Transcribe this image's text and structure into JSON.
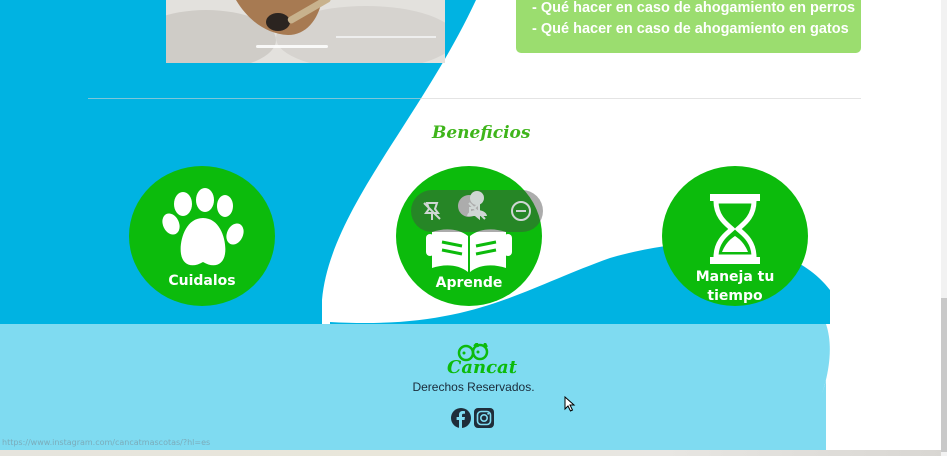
{
  "card": {
    "items": [
      "- Qué hacer en caso de ahogamiento en perros",
      "- Qué hacer en caso de ahogamiento en gatos"
    ]
  },
  "benefits": {
    "title": "Beneficios",
    "items": [
      {
        "label": "Cuidalos",
        "icon": "paw-icon"
      },
      {
        "label": "Aprende",
        "icon": "reading-book-icon"
      },
      {
        "label_line1": "Maneja tu",
        "label_line2": "tiempo",
        "icon": "hourglass-icon"
      }
    ]
  },
  "footer": {
    "brand": "Cancat",
    "rights": "Derechos Reservados.",
    "social": [
      "facebook-icon",
      "instagram-icon"
    ]
  },
  "status_bar": {
    "url": "https://www.instagram.com/cancatmascotas/?hl=es"
  },
  "colors": {
    "sky_blue": "#00b3e2",
    "light_blue": "#7fdbf1",
    "benefit_green": "#0cbb0c",
    "card_green": "#9bdd6f",
    "title_green": "#3fb51b"
  }
}
